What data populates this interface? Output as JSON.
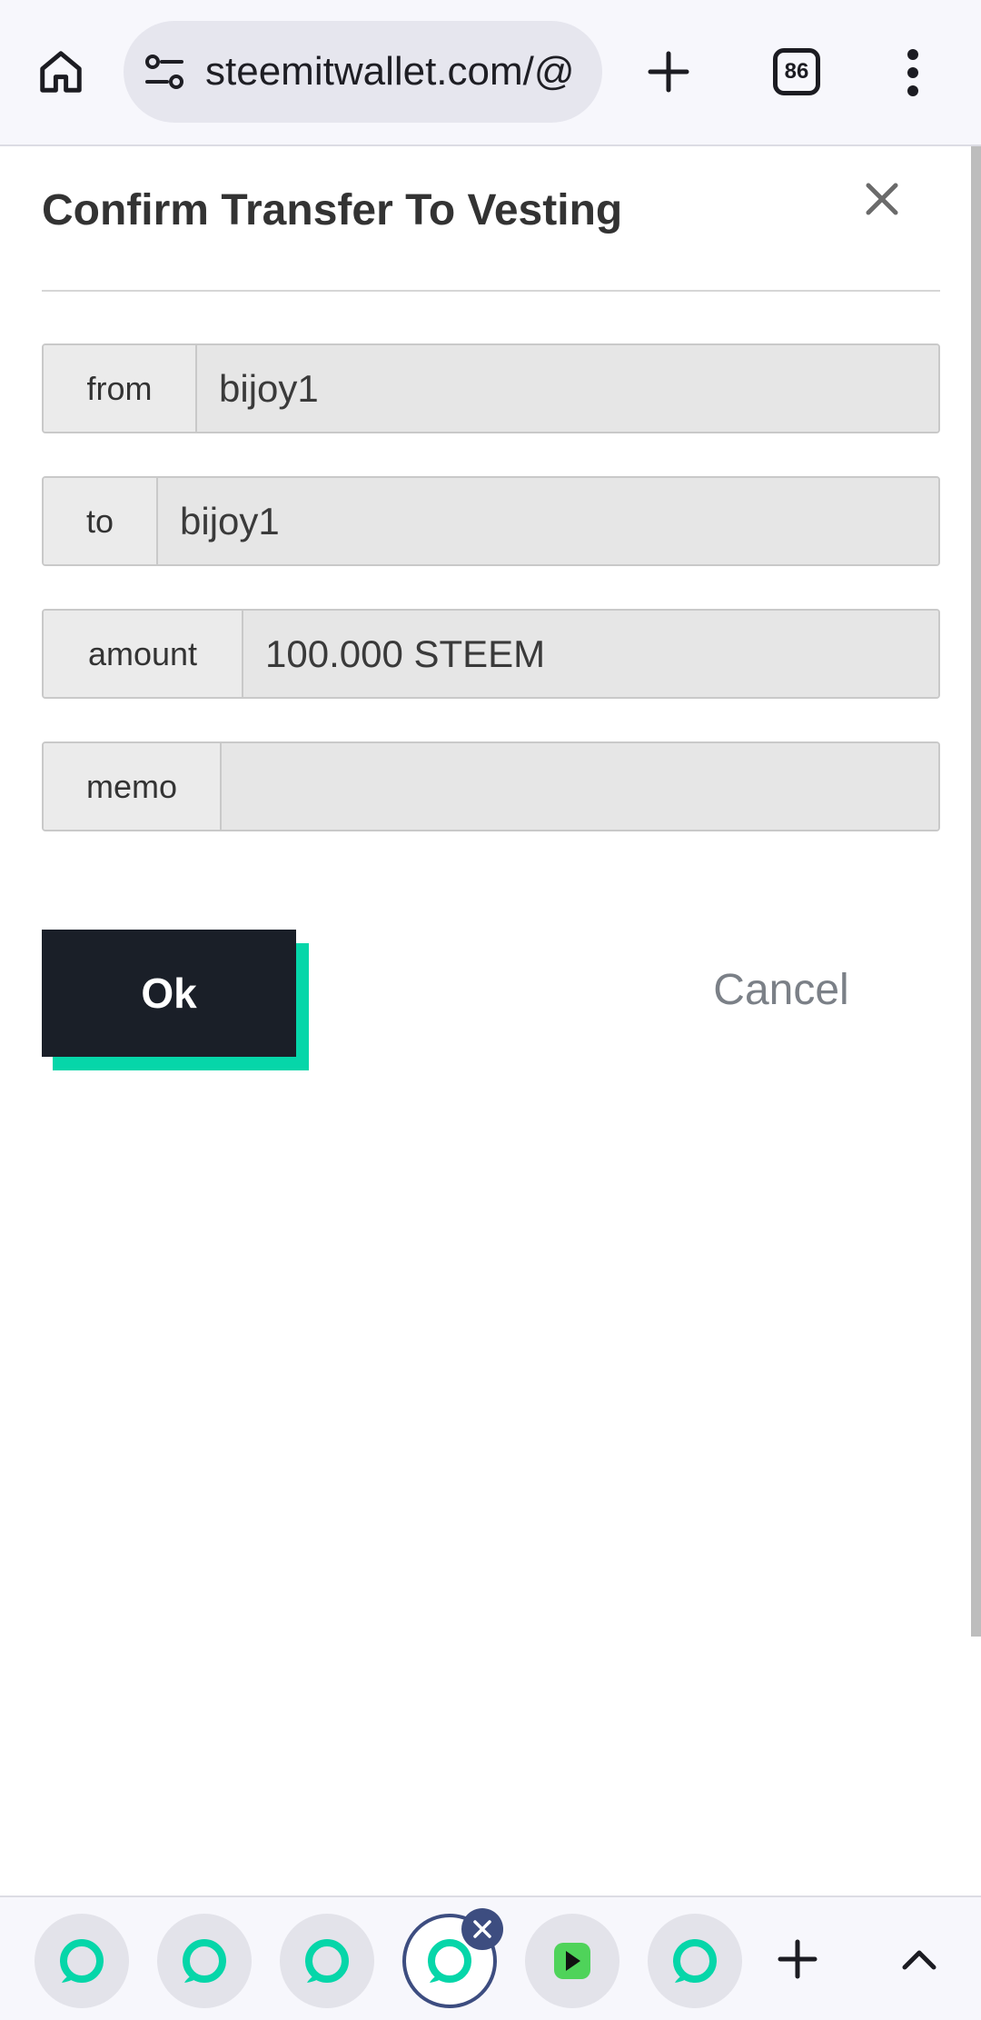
{
  "browser": {
    "url": "steemitwallet.com/@",
    "tab_count": "86",
    "icons": {
      "home": "home-icon",
      "site_info": "tune-icon",
      "new_tab": "plus-icon",
      "tab_switcher": "tab-count-icon",
      "menu": "more-vertical-icon"
    }
  },
  "modal": {
    "title": "Confirm Transfer To Vesting",
    "close_icon": "close-icon",
    "fields": [
      {
        "label": "from",
        "value": "bijoy1"
      },
      {
        "label": "to",
        "value": "bijoy1"
      },
      {
        "label": "amount",
        "value": "100.000 STEEM"
      },
      {
        "label": "memo",
        "value": ""
      }
    ],
    "ok_label": "Ok",
    "cancel_label": "Cancel"
  },
  "tab_strip": {
    "tabs": [
      {
        "icon": "steemit-icon",
        "active": false
      },
      {
        "icon": "steemit-icon",
        "active": false
      },
      {
        "icon": "steemit-icon",
        "active": false
      },
      {
        "icon": "steemit-icon",
        "active": true
      },
      {
        "icon": "green-play-icon",
        "active": false
      },
      {
        "icon": "steemit-icon",
        "active": false
      }
    ],
    "icons": {
      "new_tab": "plus-icon",
      "expand": "chevron-up-icon",
      "close_tab": "close-icon"
    }
  },
  "colors": {
    "ok_button": "#1a1f28",
    "ok_accent": "#06d6a9",
    "cancel_text": "#7b8087",
    "steemit_green": "#06d6a9",
    "active_tab_ring": "#3d4d80"
  }
}
